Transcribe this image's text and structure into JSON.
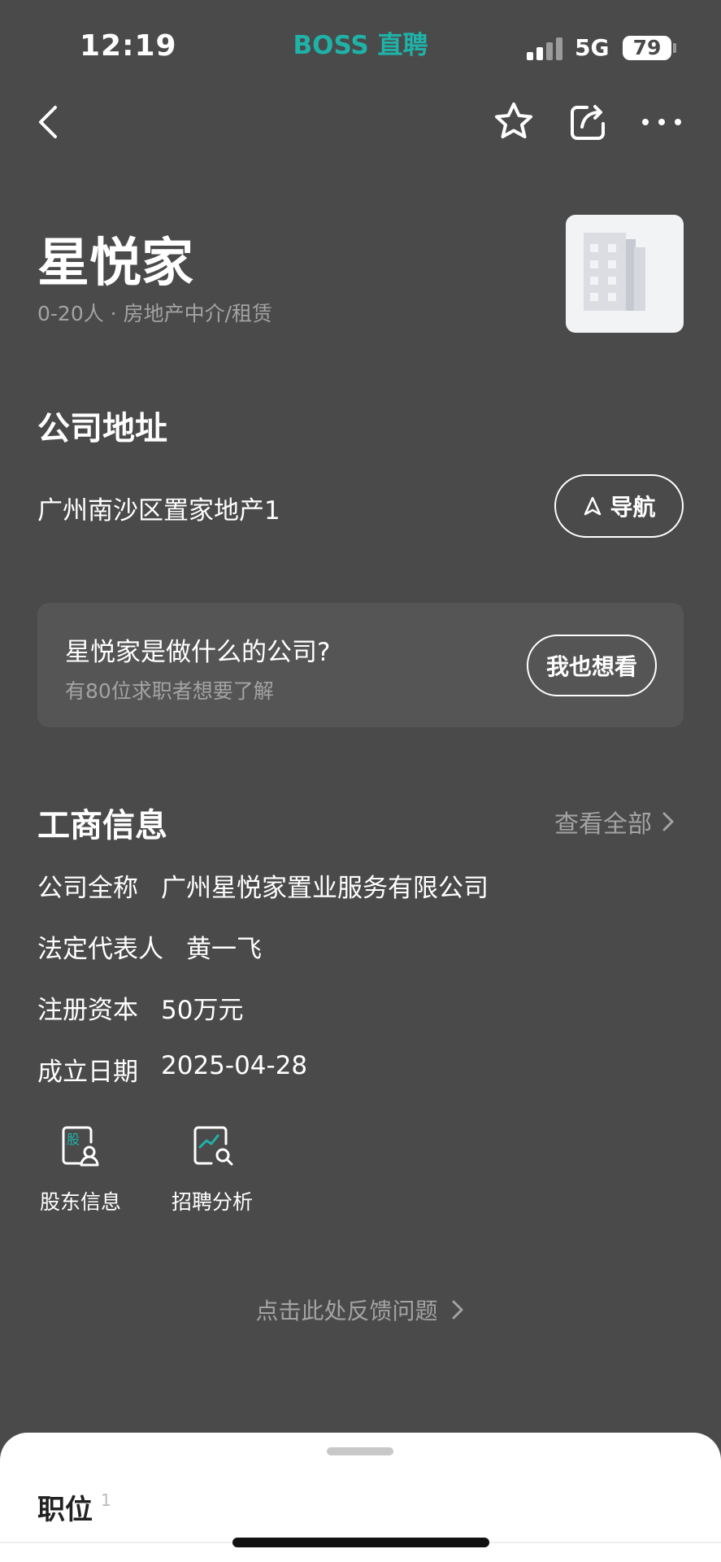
{
  "status_bar": {
    "time": "12:19",
    "brand": "BOSS 直聘",
    "network": "5G",
    "battery": "79"
  },
  "nav": {
    "back_icon": "chevron-left-icon",
    "favorite_icon": "star-icon",
    "share_icon": "share-icon",
    "more_icon": "more-icon"
  },
  "company": {
    "name": "星悦家",
    "meta": "0-20人 · 房地产中介/租赁",
    "logo_icon": "building-icon"
  },
  "address": {
    "title": "公司地址",
    "text": "广州南沙区置家地产1",
    "nav_button": "导航"
  },
  "ask": {
    "question": "星悦家是做什么的公司?",
    "sub": "有80位求职者想要了解",
    "button": "我也想看"
  },
  "business": {
    "title": "工商信息",
    "view_all": "查看全部",
    "rows": [
      {
        "label": "公司全称",
        "value": "广州星悦家置业服务有限公司"
      },
      {
        "label": "法定代表人",
        "value": "黄一飞"
      },
      {
        "label": "注册资本",
        "value": "50万元"
      },
      {
        "label": "成立日期",
        "value": "2025-04-28"
      }
    ],
    "tools": [
      {
        "label": "股东信息",
        "icon": "shareholder-icon",
        "badge": "股"
      },
      {
        "label": "招聘分析",
        "icon": "analysis-icon"
      }
    ]
  },
  "feedback": {
    "text": "点击此处反馈问题"
  },
  "sheet": {
    "title": "职位",
    "count": "1"
  },
  "colors": {
    "background": "#4a4a4a",
    "brand": "#1fb2a8",
    "secondary_text": "#a3a3a3"
  }
}
